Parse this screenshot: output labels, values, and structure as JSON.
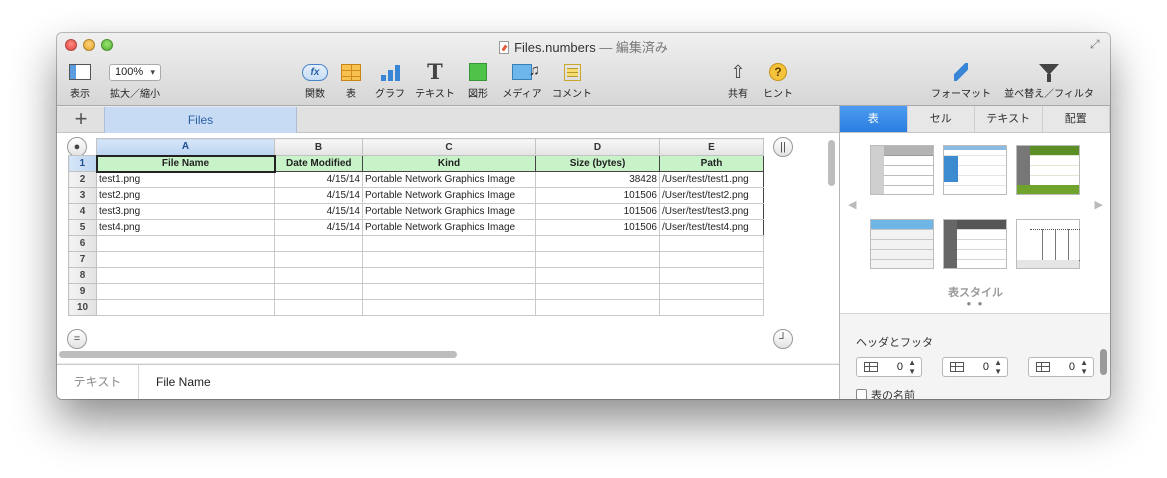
{
  "window": {
    "title": "Files.numbers",
    "title_suffix": " — 編集済み"
  },
  "toolbar": {
    "view_label": "表示",
    "zoom_value": "100%",
    "zoom_label": "拡大／縮小",
    "function_label": "関数",
    "function_icon_text": "fx",
    "table_label": "表",
    "chart_label": "グラフ",
    "text_label": "テキスト",
    "text_icon_glyph": "T",
    "shape_label": "図形",
    "media_label": "メディア",
    "comment_label": "コメント",
    "share_label": "共有",
    "share_icon_glyph": "⇧",
    "hint_label": "ヒント",
    "hint_icon_glyph": "?",
    "format_label": "フォーマット",
    "sort_filter_label": "並べ替え／フィルタ"
  },
  "sheets": {
    "add_glyph": "+",
    "tabs": [
      {
        "label": "Files",
        "selected": true
      }
    ]
  },
  "table": {
    "column_letters": [
      "A",
      "B",
      "C",
      "D",
      "E"
    ],
    "selected_column": "A",
    "header": [
      "File Name",
      "Date Modified",
      "Kind",
      "Size (bytes)",
      "Path"
    ],
    "rows": [
      [
        "test1.png",
        "4/15/14",
        "Portable Network Graphics Image",
        "38428",
        "/User/test/test1.png"
      ],
      [
        "test2.png",
        "4/15/14",
        "Portable Network Graphics Image",
        "101506",
        "/User/test/test2.png"
      ],
      [
        "test3.png",
        "4/15/14",
        "Portable Network Graphics Image",
        "101506",
        "/User/test/test3.png"
      ],
      [
        "test4.png",
        "4/15/14",
        "Portable Network Graphics Image",
        "101506",
        "/User/test/test4.png"
      ]
    ],
    "row_numbers": [
      "1",
      "2",
      "3",
      "4",
      "5",
      "6",
      "7",
      "8",
      "9",
      "10"
    ],
    "header_fill": "#c8f2c8"
  },
  "formula_bar": {
    "label": "テキスト",
    "value": "File Name"
  },
  "inspector": {
    "tabs": [
      "表",
      "セル",
      "テキスト",
      "配置"
    ],
    "active_tab": "表",
    "styles_label": "表スタイル",
    "dots": "● ●",
    "header_footer_title": "ヘッダとフッタ",
    "header_rows": "0",
    "header_columns": "0",
    "footer_rows": "0",
    "table_name_label": "表の名前",
    "accent_color": "#2a7ee0"
  }
}
